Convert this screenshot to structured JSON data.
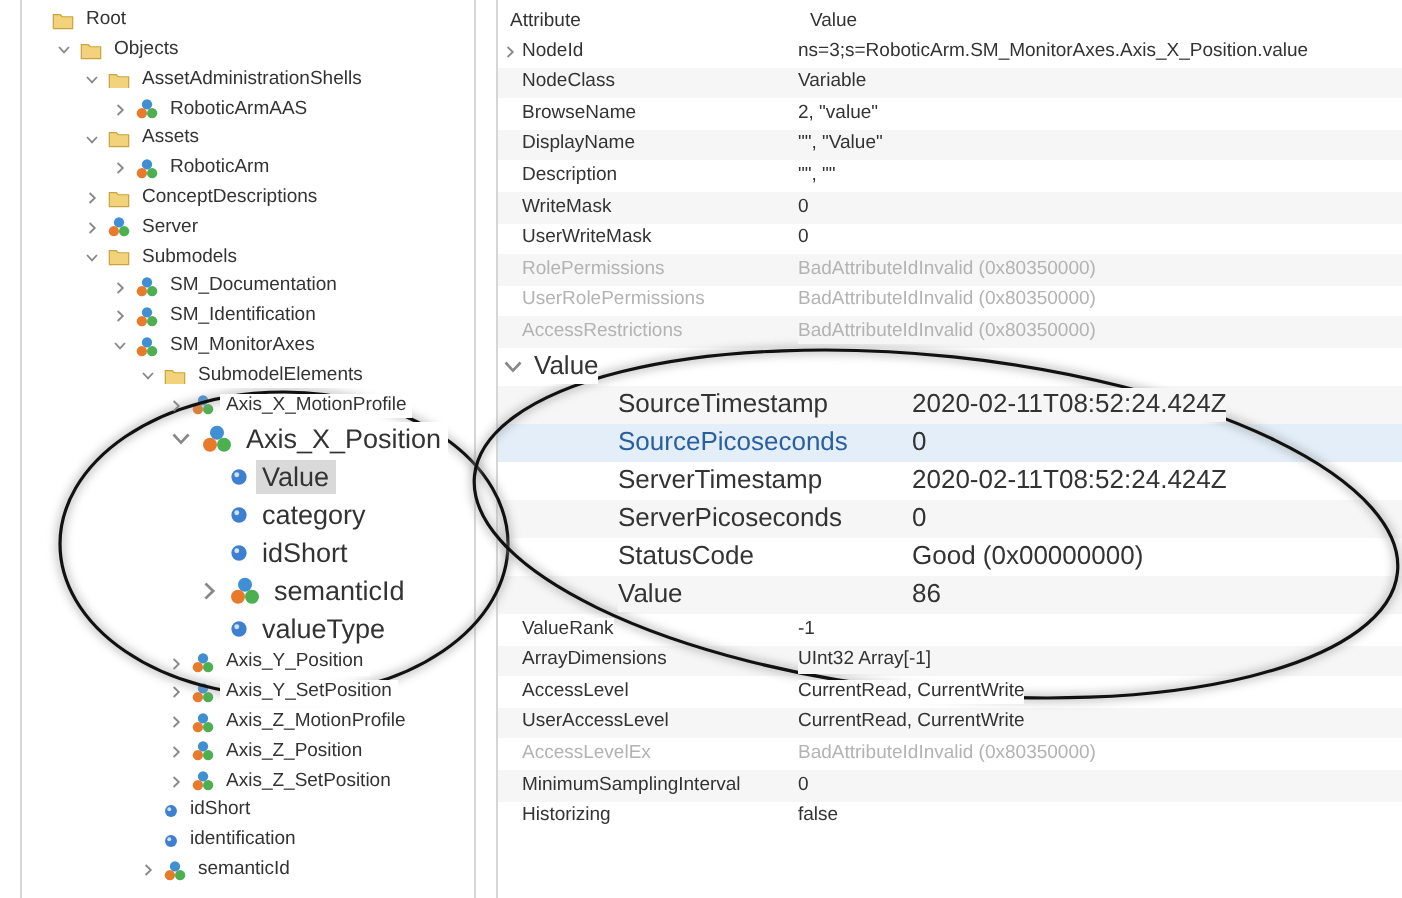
{
  "tree": [
    {
      "label": "Root",
      "kind": "folder",
      "expandable": false,
      "selected": false,
      "magnified": false,
      "children": [
        {
          "label": "Objects",
          "kind": "folder",
          "expandable": true,
          "expanded": true,
          "selected": false,
          "magnified": false,
          "children": [
            {
              "label": "AssetAdministrationShells",
              "kind": "folder",
              "expandable": true,
              "expanded": true,
              "selected": false,
              "magnified": false,
              "children": [
                {
                  "label": "RoboticArmAAS",
                  "kind": "object",
                  "expandable": true,
                  "expanded": false,
                  "selected": false,
                  "magnified": false
                }
              ]
            },
            {
              "label": "Assets",
              "kind": "folder",
              "expandable": true,
              "expanded": true,
              "selected": false,
              "magnified": false,
              "children": [
                {
                  "label": "RoboticArm",
                  "kind": "object",
                  "expandable": true,
                  "expanded": false,
                  "selected": false,
                  "magnified": false
                }
              ]
            },
            {
              "label": "ConceptDescriptions",
              "kind": "folder",
              "expandable": true,
              "expanded": false,
              "selected": false,
              "magnified": false
            },
            {
              "label": "Server",
              "kind": "object",
              "expandable": true,
              "expanded": false,
              "selected": false,
              "magnified": false
            },
            {
              "label": "Submodels",
              "kind": "folder",
              "expandable": true,
              "expanded": true,
              "selected": false,
              "magnified": false,
              "children": [
                {
                  "label": "SM_Documentation",
                  "kind": "object",
                  "expandable": true,
                  "expanded": false,
                  "selected": false,
                  "magnified": false
                },
                {
                  "label": "SM_Identification",
                  "kind": "object",
                  "expandable": true,
                  "expanded": false,
                  "selected": false,
                  "magnified": false
                },
                {
                  "label": "SM_MonitorAxes",
                  "kind": "object",
                  "expandable": true,
                  "expanded": true,
                  "selected": false,
                  "magnified": false,
                  "children": [
                    {
                      "label": "SubmodelElements",
                      "kind": "folder",
                      "expandable": true,
                      "expanded": true,
                      "selected": false,
                      "magnified": false,
                      "children": [
                        {
                          "label": "Axis_X_MotionProfile",
                          "kind": "object",
                          "expandable": true,
                          "expanded": false,
                          "selected": false,
                          "magnified": false
                        },
                        {
                          "label": "Axis_X_Position",
                          "kind": "object",
                          "expandable": true,
                          "expanded": true,
                          "selected": false,
                          "magnified": true,
                          "children": [
                            {
                              "label": "Value",
                              "kind": "variable",
                              "expandable": false,
                              "selected": true,
                              "magnified": true
                            },
                            {
                              "label": "category",
                              "kind": "variable",
                              "expandable": false,
                              "selected": false,
                              "magnified": true
                            },
                            {
                              "label": "idShort",
                              "kind": "variable",
                              "expandable": false,
                              "selected": false,
                              "magnified": true
                            },
                            {
                              "label": "semanticId",
                              "kind": "object",
                              "expandable": true,
                              "expanded": false,
                              "selected": false,
                              "magnified": true
                            },
                            {
                              "label": "valueType",
                              "kind": "variable",
                              "expandable": false,
                              "selected": false,
                              "magnified": true
                            }
                          ]
                        },
                        {
                          "label": "Axis_Y_Position",
                          "kind": "object",
                          "expandable": true,
                          "expanded": false,
                          "selected": false,
                          "magnified": false
                        },
                        {
                          "label": "Axis_Y_SetPosition",
                          "kind": "object",
                          "expandable": true,
                          "expanded": false,
                          "selected": false,
                          "magnified": false
                        },
                        {
                          "label": "Axis_Z_MotionProfile",
                          "kind": "object",
                          "expandable": true,
                          "expanded": false,
                          "selected": false,
                          "magnified": false
                        },
                        {
                          "label": "Axis_Z_Position",
                          "kind": "object",
                          "expandable": true,
                          "expanded": false,
                          "selected": false,
                          "magnified": false
                        },
                        {
                          "label": "Axis_Z_SetPosition",
                          "kind": "object",
                          "expandable": true,
                          "expanded": false,
                          "selected": false,
                          "magnified": false
                        }
                      ]
                    },
                    {
                      "label": "idShort",
                      "kind": "variable",
                      "expandable": false,
                      "selected": false,
                      "magnified": false
                    },
                    {
                      "label": "identification",
                      "kind": "variable",
                      "expandable": false,
                      "selected": false,
                      "magnified": false
                    },
                    {
                      "label": "semanticId",
                      "kind": "object",
                      "expandable": true,
                      "expanded": false,
                      "selected": false,
                      "magnified": false
                    }
                  ]
                }
              ]
            }
          ]
        }
      ]
    }
  ],
  "table": {
    "columns": [
      "Attribute",
      "Value"
    ],
    "rows": [
      {
        "attribute": "NodeId",
        "value": "ns=3;s=RoboticArm.SM_MonitorAxes.Axis_X_Position.value",
        "expandable": true,
        "expanded": false,
        "disabled": false,
        "selected": false,
        "magnified": false
      },
      {
        "attribute": "NodeClass",
        "value": "Variable",
        "expandable": false,
        "disabled": false,
        "selected": false,
        "magnified": false
      },
      {
        "attribute": "BrowseName",
        "value": "2, \"value\"",
        "expandable": false,
        "disabled": false,
        "selected": false,
        "magnified": false
      },
      {
        "attribute": "DisplayName",
        "value": "\"\", \"Value\"",
        "expandable": false,
        "disabled": false,
        "selected": false,
        "magnified": false
      },
      {
        "attribute": "Description",
        "value": "\"\", \"\"",
        "expandable": false,
        "disabled": false,
        "selected": false,
        "magnified": false
      },
      {
        "attribute": "WriteMask",
        "value": "0",
        "expandable": false,
        "disabled": false,
        "selected": false,
        "magnified": false
      },
      {
        "attribute": "UserWriteMask",
        "value": "0",
        "expandable": false,
        "disabled": false,
        "selected": false,
        "magnified": false
      },
      {
        "attribute": "RolePermissions",
        "value": "BadAttributeIdInvalid (0x80350000)",
        "expandable": false,
        "disabled": true,
        "selected": false,
        "magnified": false
      },
      {
        "attribute": "UserRolePermissions",
        "value": "BadAttributeIdInvalid (0x80350000)",
        "expandable": false,
        "disabled": true,
        "selected": false,
        "magnified": false
      },
      {
        "attribute": "AccessRestrictions",
        "value": "BadAttributeIdInvalid (0x80350000)",
        "expandable": false,
        "disabled": true,
        "selected": false,
        "magnified": false
      },
      {
        "attribute": "Value",
        "expandable": true,
        "expanded": true,
        "disabled": false,
        "selected": false,
        "magnified": true,
        "children": [
          {
            "attribute": "SourceTimestamp",
            "value": "2020-02-11T08:52:24.424Z",
            "disabled": false,
            "selected": false,
            "magnified": true
          },
          {
            "attribute": "SourcePicoseconds",
            "value": "0",
            "disabled": false,
            "selected": true,
            "magnified": true
          },
          {
            "attribute": "ServerTimestamp",
            "value": "2020-02-11T08:52:24.424Z",
            "disabled": false,
            "selected": false,
            "magnified": true
          },
          {
            "attribute": "ServerPicoseconds",
            "value": "0",
            "disabled": false,
            "selected": false,
            "magnified": true
          },
          {
            "attribute": "StatusCode",
            "value": "Good (0x00000000)",
            "disabled": false,
            "selected": false,
            "magnified": true
          },
          {
            "attribute": "Value",
            "value": "86",
            "disabled": false,
            "selected": false,
            "magnified": true
          }
        ]
      },
      {
        "attribute": "ValueRank",
        "value": "-1",
        "expandable": false,
        "disabled": false,
        "selected": false,
        "magnified": false
      },
      {
        "attribute": "ArrayDimensions",
        "value": "UInt32 Array[-1]",
        "expandable": false,
        "disabled": false,
        "selected": false,
        "magnified": false
      },
      {
        "attribute": "AccessLevel",
        "value": "CurrentRead, CurrentWrite",
        "expandable": false,
        "disabled": false,
        "selected": false,
        "magnified": false
      },
      {
        "attribute": "UserAccessLevel",
        "value": "CurrentRead, CurrentWrite",
        "expandable": false,
        "disabled": false,
        "selected": false,
        "magnified": false
      },
      {
        "attribute": "AccessLevelEx",
        "value": "BadAttributeIdInvalid (0x80350000)",
        "expandable": false,
        "disabled": true,
        "selected": false,
        "magnified": false
      },
      {
        "attribute": "MinimumSamplingInterval",
        "value": "0",
        "expandable": false,
        "disabled": false,
        "selected": false,
        "magnified": false
      },
      {
        "attribute": "Historizing",
        "value": "false",
        "expandable": false,
        "disabled": false,
        "selected": false,
        "magnified": false
      }
    ]
  }
}
